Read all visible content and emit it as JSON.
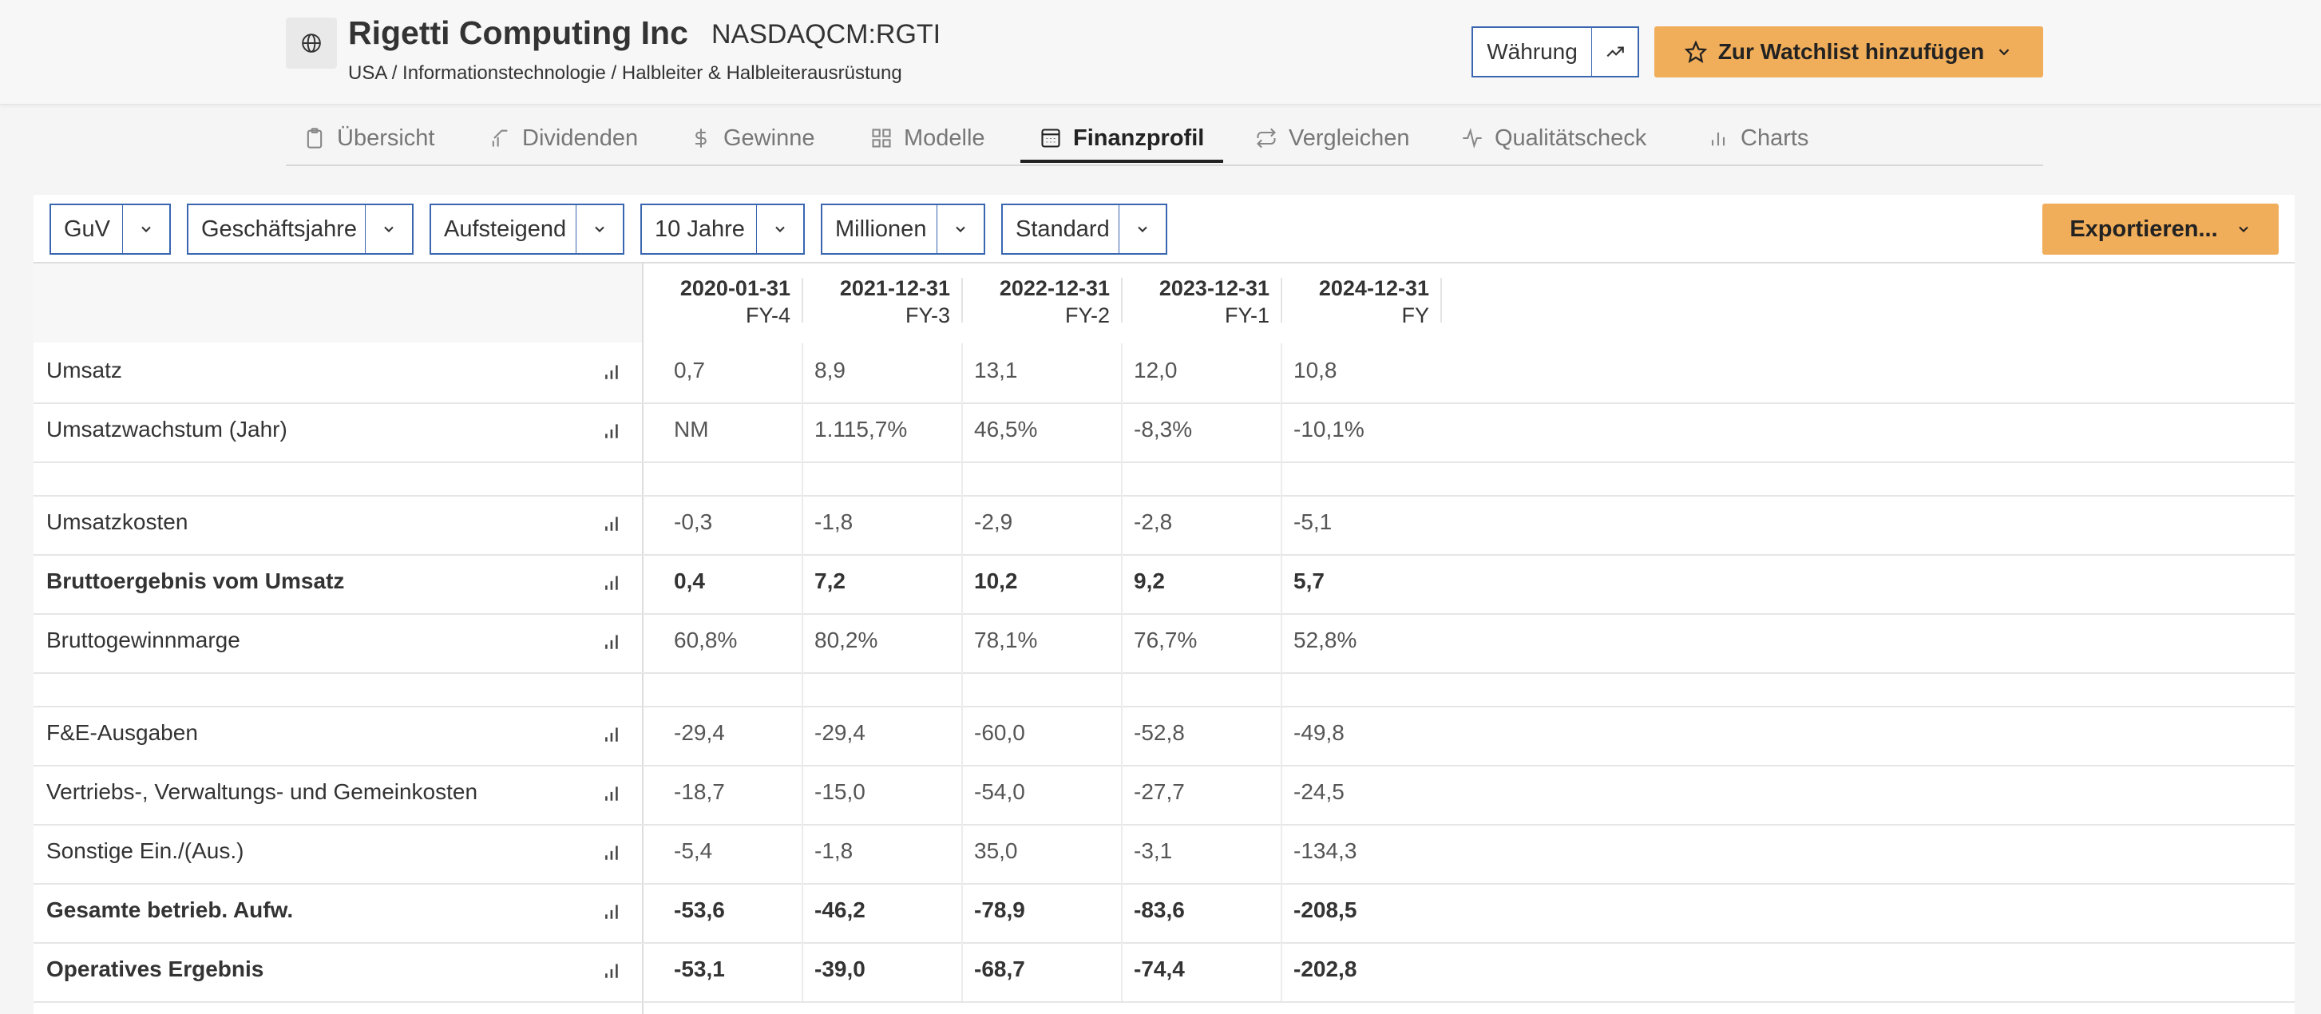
{
  "company": {
    "name": "Rigetti Computing Inc",
    "ticker": "NASDAQCM:RGTI",
    "breadcrumb": "USA / Informationstechnologie / Halbleiter & Halbleiterausrüstung",
    "icon": "globe-icon"
  },
  "header_actions": {
    "currency_label": "Währung",
    "trend_icon": "trend-icon",
    "watchlist_label": "Zur Watchlist hinzufügen"
  },
  "tabs": [
    {
      "label": "Übersicht",
      "icon": "clipboard-icon"
    },
    {
      "label": "Dividenden",
      "icon": "growth-icon"
    },
    {
      "label": "Gewinne",
      "icon": "dollar-icon"
    },
    {
      "label": "Modelle",
      "icon": "grid-icon"
    },
    {
      "label": "Finanzprofil",
      "icon": "calculator-icon",
      "active": true
    },
    {
      "label": "Vergleichen",
      "icon": "swap-icon"
    },
    {
      "label": "Qualitätscheck",
      "icon": "pulse-icon"
    },
    {
      "label": "Charts",
      "icon": "bar-chart-icon"
    }
  ],
  "controls": {
    "dropdowns": [
      "GuV",
      "Geschäftsjahre",
      "Aufsteigend",
      "10 Jahre",
      "Millionen",
      "Standard"
    ],
    "export_label": "Exportieren..."
  },
  "table": {
    "columns": [
      {
        "date": "2020-01-31",
        "fy": "FY-4"
      },
      {
        "date": "2021-12-31",
        "fy": "FY-3"
      },
      {
        "date": "2022-12-31",
        "fy": "FY-2"
      },
      {
        "date": "2023-12-31",
        "fy": "FY-1"
      },
      {
        "date": "2024-12-31",
        "fy": "FY"
      }
    ],
    "rows": [
      {
        "label": "Umsatz",
        "values": [
          "0,7",
          "8,9",
          "13,1",
          "12,0",
          "10,8"
        ],
        "bold": false
      },
      {
        "label": "Umsatzwachstum (Jahr)",
        "values": [
          "NM",
          "1.115,7%",
          "46,5%",
          "-8,3%",
          "-10,1%"
        ],
        "bold": false
      },
      {
        "spacer": true
      },
      {
        "label": "Umsatzkosten",
        "values": [
          "-0,3",
          "-1,8",
          "-2,9",
          "-2,8",
          "-5,1"
        ],
        "bold": false
      },
      {
        "label": "Bruttoergebnis vom Umsatz",
        "values": [
          "0,4",
          "7,2",
          "10,2",
          "9,2",
          "5,7"
        ],
        "bold": true
      },
      {
        "label": "Bruttogewinnmarge",
        "values": [
          "60,8%",
          "80,2%",
          "78,1%",
          "76,7%",
          "52,8%"
        ],
        "bold": false
      },
      {
        "spacer": true
      },
      {
        "label": "F&E-Ausgaben",
        "values": [
          "-29,4",
          "-29,4",
          "-60,0",
          "-52,8",
          "-49,8"
        ],
        "bold": false
      },
      {
        "label": "Vertriebs-, Verwaltungs- und Gemeinkosten",
        "values": [
          "-18,7",
          "-15,0",
          "-54,0",
          "-27,7",
          "-24,5"
        ],
        "bold": false
      },
      {
        "label": "Sonstige Ein./(Aus.)",
        "values": [
          "-5,4",
          "-1,8",
          "35,0",
          "-3,1",
          "-134,3"
        ],
        "bold": false
      },
      {
        "label": "Gesamte betrieb. Aufw.",
        "values": [
          "-53,6",
          "-46,2",
          "-78,9",
          "-83,6",
          "-208,5"
        ],
        "bold": true
      },
      {
        "label": "Operatives Ergebnis",
        "values": [
          "-53,1",
          "-39,0",
          "-68,7",
          "-74,4",
          "-202,8"
        ],
        "bold": true
      }
    ]
  }
}
